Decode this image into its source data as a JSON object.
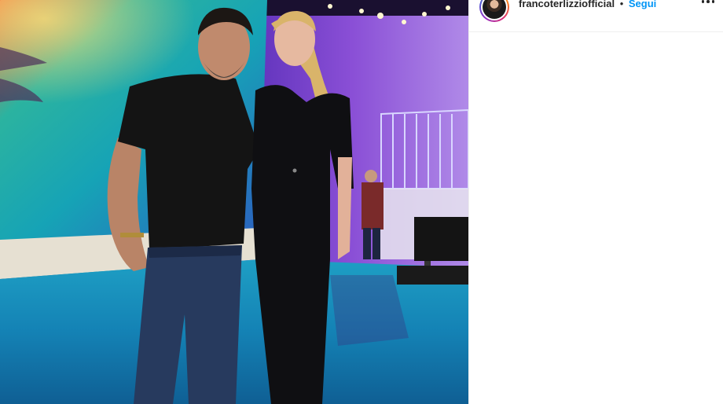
{
  "post": {
    "photo": {
      "alt_subjects": [
        "man in black t-shirt and jeans",
        "woman in black jumpsuit"
      ],
      "scene": "TV studio with purple lighting and reflective blue floor"
    }
  },
  "header": {
    "username": "francoterlizziofficial",
    "separator": "•",
    "follow_label": "Segui",
    "more_icon": "more-options-icon"
  },
  "colors": {
    "follow": "#0095f6",
    "text": "#262626",
    "divider": "#efefef"
  }
}
